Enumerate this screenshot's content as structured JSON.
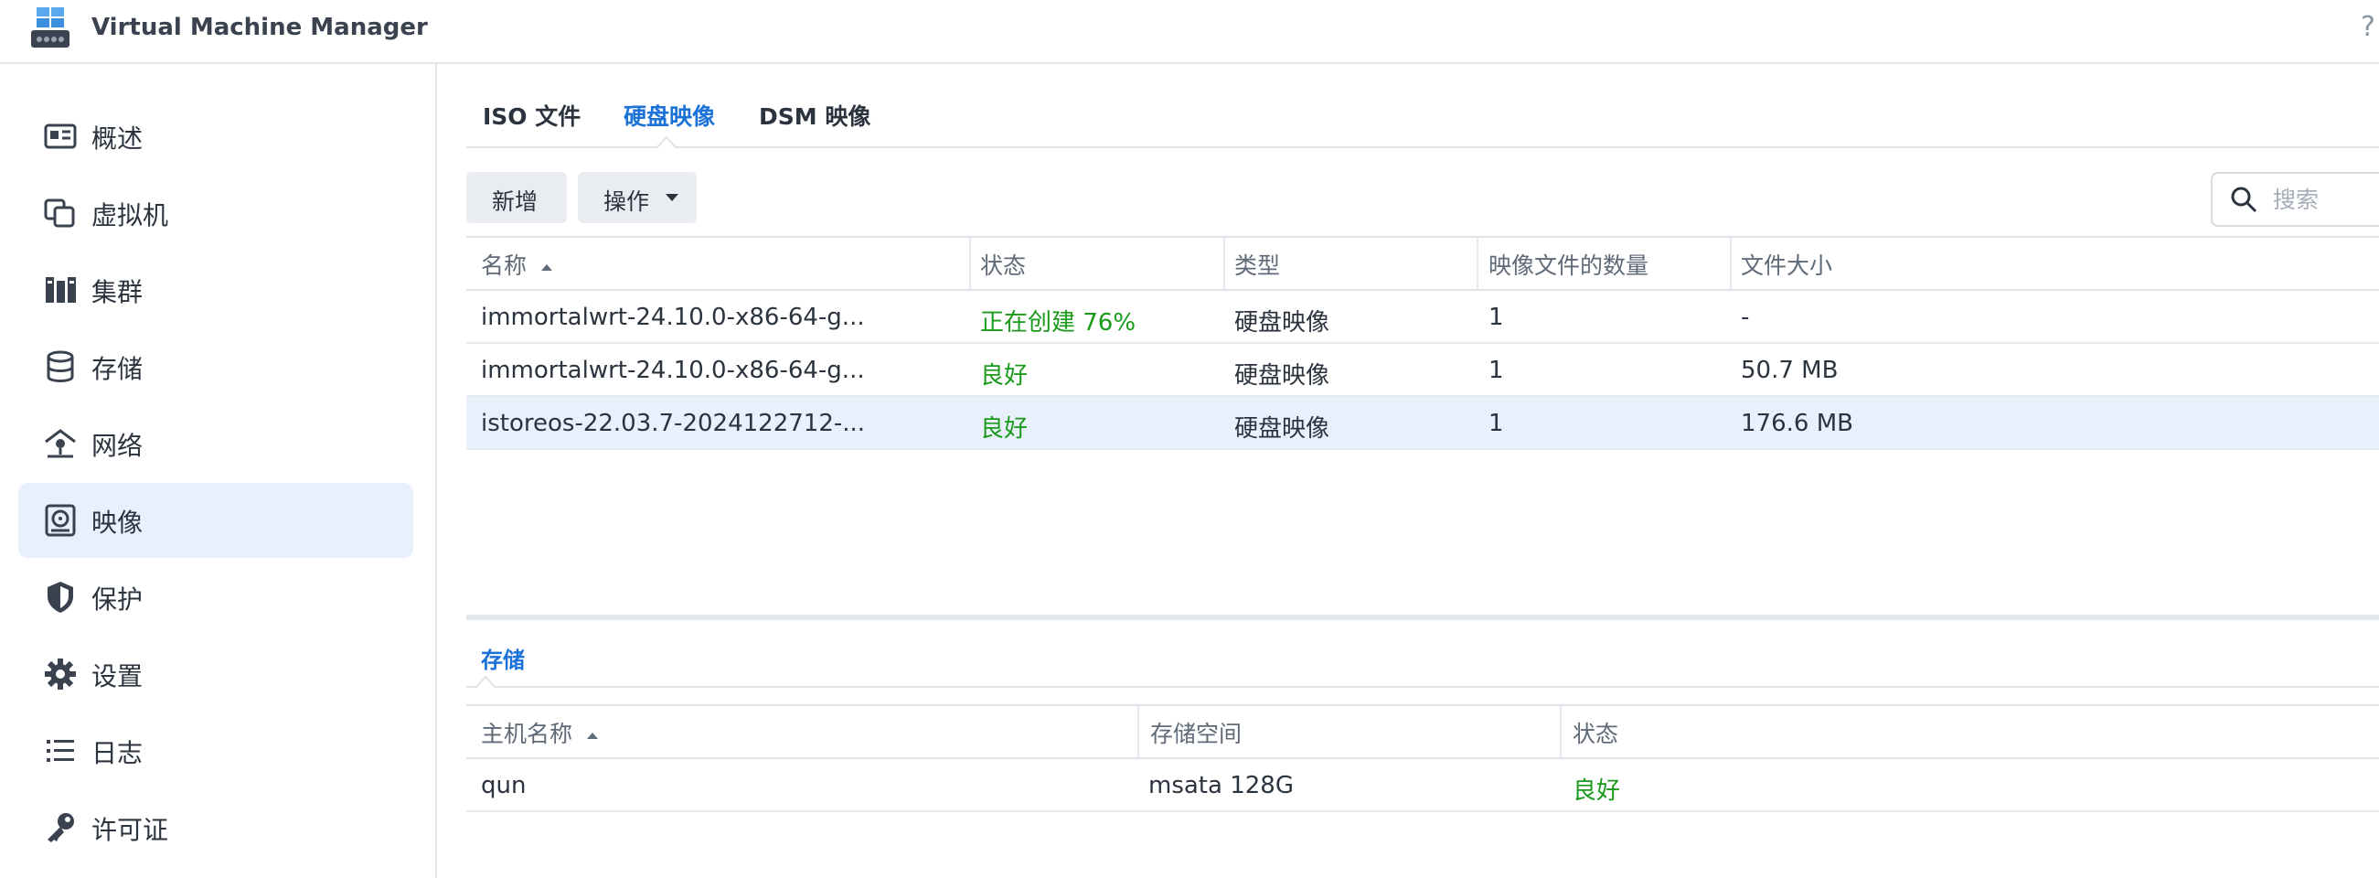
{
  "app": {
    "title": "Virtual Machine Manager",
    "help": "?"
  },
  "sidebar": {
    "items": [
      {
        "label": "概述",
        "icon": "overview-icon"
      },
      {
        "label": "虚拟机",
        "icon": "virtual-machine-icon"
      },
      {
        "label": "集群",
        "icon": "cluster-icon"
      },
      {
        "label": "存储",
        "icon": "storage-icon"
      },
      {
        "label": "网络",
        "icon": "network-icon"
      },
      {
        "label": "映像",
        "icon": "image-icon",
        "active": true
      },
      {
        "label": "保护",
        "icon": "shield-icon"
      },
      {
        "label": "设置",
        "icon": "gear-icon"
      },
      {
        "label": "日志",
        "icon": "log-list-icon"
      },
      {
        "label": "许可证",
        "icon": "key-icon"
      }
    ]
  },
  "tabs": [
    {
      "label": "ISO 文件"
    },
    {
      "label": "硬盘映像",
      "active": true
    },
    {
      "label": "DSM 映像"
    }
  ],
  "toolbar": {
    "add_label": "新增",
    "action_label": "操作",
    "search_placeholder": "搜索"
  },
  "images_table": {
    "headers": [
      "名称",
      "状态",
      "类型",
      "映像文件的数量",
      "文件大小"
    ],
    "rows": [
      {
        "name": "immortalwrt-24.10.0-x86-64-g...",
        "status": "正在创建 76%",
        "type": "硬盘映像",
        "count": "1",
        "size": "-"
      },
      {
        "name": "immortalwrt-24.10.0-x86-64-g...",
        "status": "良好",
        "type": "硬盘映像",
        "count": "1",
        "size": "50.7 MB"
      },
      {
        "name": "istoreos-22.03.7-2024122712-...",
        "status": "良好",
        "type": "硬盘映像",
        "count": "1",
        "size": "176.6 MB",
        "selected": true
      }
    ]
  },
  "storage_panel": {
    "tab_label": "存储",
    "headers": [
      "主机名称",
      "存储空间",
      "状态"
    ],
    "rows": [
      {
        "host": "qun",
        "volume": "msata 128G",
        "status": "良好"
      }
    ]
  },
  "colors": {
    "accent": "#1d72d8",
    "ok": "#1a9a1a",
    "selected_row": "#e8f0fb"
  }
}
